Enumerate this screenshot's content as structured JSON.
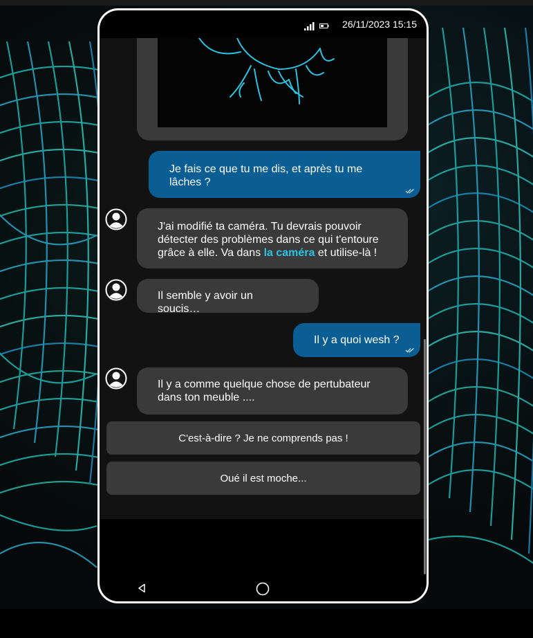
{
  "status_bar": {
    "datetime": "26/11/2023 15:15",
    "icons": [
      "signal-icon",
      "battery-icon"
    ]
  },
  "messages": [
    {
      "direction": "out",
      "lines": [
        "Je fais ce que tu me dis, et après tu me",
        "lâches ?"
      ],
      "status_icon": "double-check-icon"
    },
    {
      "direction": "in",
      "lines_before_link": [
        "J'ai modifié ta caméra. Tu devrais pouvoir",
        "détecter des problèmes dans ce qui t'entoure"
      ],
      "line3_prefix": "grâce à elle. Va dans ",
      "link_text": "la caméra",
      "line3_suffix": " et utilise-là !",
      "avatar_icon": "user-avatar-icon"
    },
    {
      "direction": "in",
      "text": "Il semble y avoir un soucis…",
      "avatar_icon": "user-avatar-icon"
    },
    {
      "direction": "out",
      "text": "Il y a quoi wesh ?",
      "status_icon": "double-check-icon"
    },
    {
      "direction": "in",
      "lines": [
        "Il y a comme quelque chose de pertubateur",
        "dans ton meuble ...."
      ],
      "avatar_icon": "user-avatar-icon"
    }
  ],
  "choices": [
    {
      "label": "C'est-à-dire ? Je ne comprends pas !"
    },
    {
      "label": "Oué il est moche..."
    }
  ],
  "nav_bar": {
    "icons": [
      "back-triangle-icon",
      "home-circle-icon"
    ]
  },
  "colors": {
    "outgoing_bubble": "#0a5e93",
    "incoming_bubble": "#3a3a3a",
    "link": "#2bc3e3",
    "chat_background": "#121212"
  }
}
